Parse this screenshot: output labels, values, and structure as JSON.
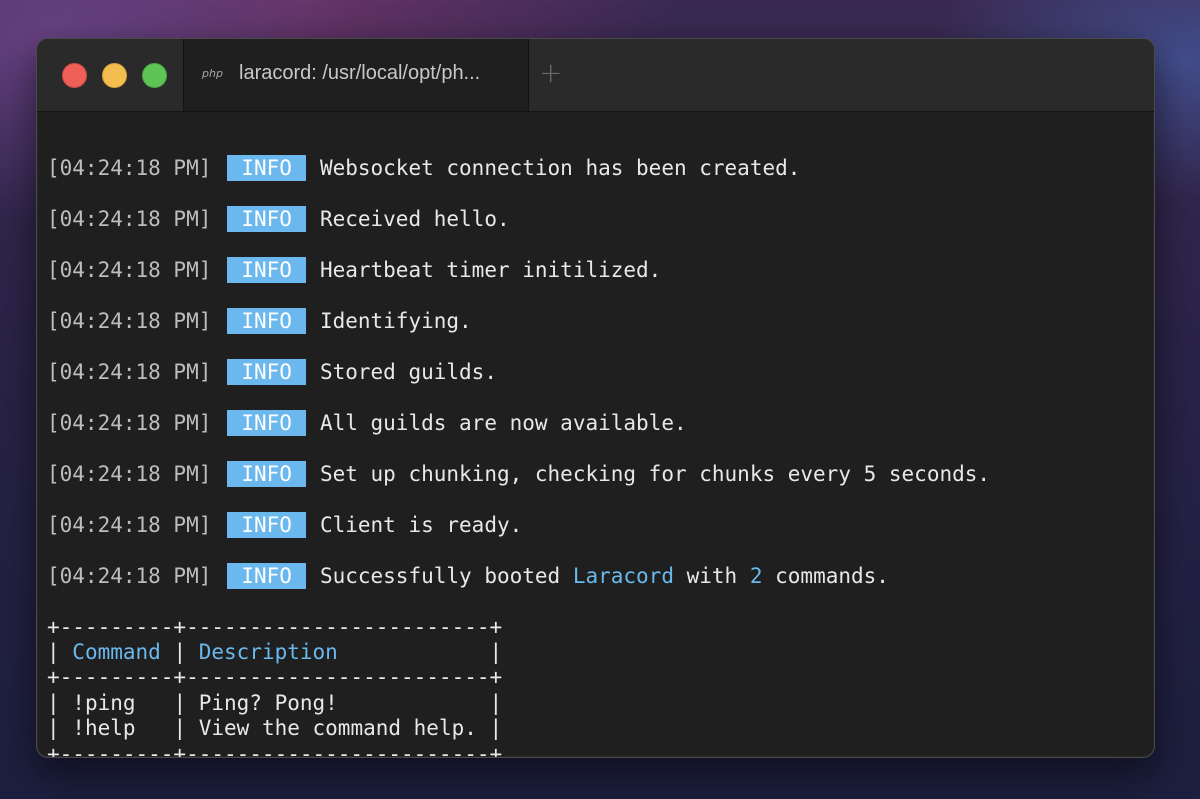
{
  "window": {
    "tab_icon": "php",
    "tab_title": "laracord: /usr/local/opt/ph...",
    "new_tab_glyph": "+"
  },
  "colors": {
    "accent": "#6ab8ee",
    "terminal_bg": "#1f1f1f",
    "close": "#ee5f57",
    "minimize": "#f4bd4f",
    "zoom": "#5ec454"
  },
  "logs": [
    {
      "timestamp": "[04:24:18 PM]",
      "level": "INFO",
      "message": "Websocket connection has been created."
    },
    {
      "timestamp": "[04:24:18 PM]",
      "level": "INFO",
      "message": "Received hello."
    },
    {
      "timestamp": "[04:24:18 PM]",
      "level": "INFO",
      "message": "Heartbeat timer initilized."
    },
    {
      "timestamp": "[04:24:18 PM]",
      "level": "INFO",
      "message": "Identifying."
    },
    {
      "timestamp": "[04:24:18 PM]",
      "level": "INFO",
      "message": "Stored guilds."
    },
    {
      "timestamp": "[04:24:18 PM]",
      "level": "INFO",
      "message": "All guilds are now available."
    },
    {
      "timestamp": "[04:24:18 PM]",
      "level": "INFO",
      "message": "Set up chunking, checking for chunks every 5 seconds."
    },
    {
      "timestamp": "[04:24:18 PM]",
      "level": "INFO",
      "message": "Client is ready."
    },
    {
      "timestamp": "[04:24:18 PM]",
      "level": "INFO",
      "message_parts": [
        "Successfully booted ",
        "Laracord",
        " with ",
        "2",
        " commands."
      ]
    }
  ],
  "commands_table": {
    "border": "+---------+------------------------+",
    "headers": [
      "Command",
      "Description"
    ],
    "rows": [
      {
        "command": "!ping",
        "description": "Ping? Pong!"
      },
      {
        "command": "!help",
        "description": "View the command help."
      }
    ]
  }
}
